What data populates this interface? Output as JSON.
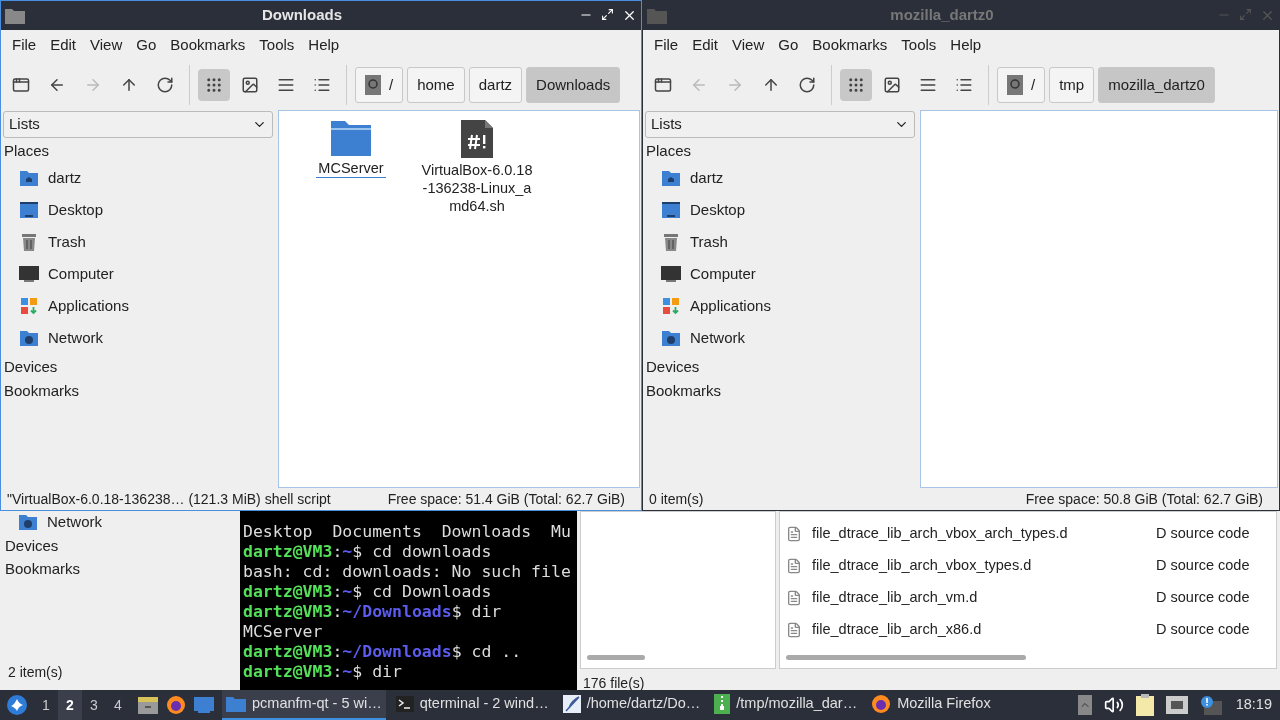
{
  "windows": [
    {
      "title": "Downloads",
      "active": true,
      "menu": [
        "File",
        "Edit",
        "View",
        "Go",
        "Bookmarks",
        "Tools",
        "Help"
      ],
      "back_disabled": false,
      "forward_disabled": true,
      "view_modes": [
        {
          "kind": "icons",
          "selected": true
        },
        {
          "kind": "thumbnails",
          "selected": false
        },
        {
          "kind": "compact",
          "selected": false
        },
        {
          "kind": "details",
          "selected": false
        }
      ],
      "path": [
        {
          "kind": "root",
          "label": "/",
          "selected": false
        },
        {
          "kind": "dir",
          "label": "home",
          "selected": false
        },
        {
          "kind": "dir",
          "label": "dartz",
          "selected": false
        },
        {
          "kind": "dir",
          "label": "Downloads",
          "selected": true
        }
      ],
      "panel_mode": "Lists",
      "sidebar": [
        {
          "label": "Places",
          "items": [
            {
              "kind": "home",
              "label": "dartz"
            },
            {
              "kind": "desktop",
              "label": "Desktop"
            },
            {
              "kind": "trash",
              "label": "Trash"
            },
            {
              "kind": "computer",
              "label": "Computer"
            },
            {
              "kind": "apps",
              "label": "Applications"
            },
            {
              "kind": "network",
              "label": "Network"
            }
          ]
        },
        {
          "label": "Devices"
        },
        {
          "label": "Bookmarks"
        }
      ],
      "files": [
        {
          "kind": "folder",
          "name": "MCServer",
          "focused": true
        },
        {
          "kind": "script",
          "name": "VirtualBox-6.0.18-136238-Linux_amd64.sh",
          "focused": false
        }
      ],
      "status_left": "\"VirtualBox-6.0.18-136238… (121.3 MiB) shell script",
      "status_right": "Free space: 51.4 GiB (Total: 62.7 GiB)"
    },
    {
      "title": "mozilla_dartz0",
      "active": false,
      "menu": [
        "File",
        "Edit",
        "View",
        "Go",
        "Bookmarks",
        "Tools",
        "Help"
      ],
      "back_disabled": true,
      "forward_disabled": true,
      "view_modes": [
        {
          "kind": "icons",
          "selected": true
        },
        {
          "kind": "thumbnails",
          "selected": false
        },
        {
          "kind": "compact",
          "selected": false
        },
        {
          "kind": "details",
          "selected": false
        }
      ],
      "path": [
        {
          "kind": "root",
          "label": "/",
          "selected": false
        },
        {
          "kind": "dir",
          "label": "tmp",
          "selected": false
        },
        {
          "kind": "dir",
          "label": "mozilla_dartz0",
          "selected": true
        }
      ],
      "panel_mode": "Lists",
      "sidebar": [
        {
          "label": "Places",
          "items": [
            {
              "kind": "home",
              "label": "dartz"
            },
            {
              "kind": "desktop",
              "label": "Desktop"
            },
            {
              "kind": "trash",
              "label": "Trash"
            },
            {
              "kind": "computer",
              "label": "Computer"
            },
            {
              "kind": "apps",
              "label": "Applications"
            },
            {
              "kind": "network",
              "label": "Network"
            }
          ]
        },
        {
          "label": "Devices"
        },
        {
          "label": "Bookmarks"
        }
      ],
      "status_left": "0 item(s)",
      "status_right": "Free space: 50.8 GiB (Total: 62.7 GiB)"
    }
  ],
  "back_file_manager": {
    "items": [
      {
        "kind": "network",
        "label": "Network"
      }
    ],
    "sections": [
      "Devices",
      "Bookmarks"
    ],
    "status": "2 item(s)"
  },
  "terminal": {
    "lines": [
      {
        "kind": "output",
        "text": "Desktop  Documents  Downloads  Mu"
      },
      {
        "kind": "prompt",
        "user": "dartz@VM3",
        "sep": ":",
        "path": "~",
        "command": "$ cd downloads"
      },
      {
        "kind": "output",
        "text": "bash: cd: downloads: No such file"
      },
      {
        "kind": "prompt",
        "user": "dartz@VM3",
        "sep": ":",
        "path": "~",
        "command": "$ cd Downloads"
      },
      {
        "kind": "prompt",
        "user": "dartz@VM3",
        "sep": ":",
        "path": "~/Downloads",
        "command": "$ dir"
      },
      {
        "kind": "output",
        "text": "MCServer"
      },
      {
        "kind": "prompt",
        "user": "dartz@VM3",
        "sep": ":",
        "path": "~/Downloads",
        "command": "$ cd .."
      },
      {
        "kind": "prompt",
        "user": "dartz@VM3",
        "sep": ":",
        "path": "~",
        "command": "$ dir"
      }
    ]
  },
  "source_file_manager": {
    "rows": [
      {
        "name": "file_dtrace_lib_arch_vbox_arch_types.d",
        "type": "D source code"
      },
      {
        "name": "file_dtrace_lib_arch_vbox_types.d",
        "type": "D source code"
      },
      {
        "name": "file_dtrace_lib_arch_vm.d",
        "type": "D source code"
      },
      {
        "name": "file_dtrace_lib_arch_x86.d",
        "type": "D source code"
      }
    ],
    "status": "176 file(s)"
  },
  "taskbar": {
    "workspaces": [
      {
        "label": "1",
        "selected": false
      },
      {
        "label": "2",
        "selected": true
      },
      {
        "label": "3",
        "selected": false
      },
      {
        "label": "4",
        "selected": false
      }
    ],
    "launchers": [
      {
        "kind": "files"
      },
      {
        "kind": "firefox"
      },
      {
        "kind": "desktop"
      }
    ],
    "tasks": [
      {
        "kind": "folder",
        "label": "pcmanfm-qt - 5 wi…",
        "selected": true
      },
      {
        "kind": "terminal",
        "label": "qterminal - 2 wind…",
        "selected": false
      },
      {
        "kind": "editor",
        "label": "/home/dartz/Do…",
        "selected": false
      },
      {
        "kind": "archive",
        "label": "/tmp/mozilla_dar…",
        "selected": false
      },
      {
        "kind": "firefox",
        "label": "Mozilla Firefox",
        "selected": false
      }
    ],
    "tray": [
      {
        "kind": "up"
      },
      {
        "kind": "volume"
      },
      {
        "kind": "clipboard"
      },
      {
        "kind": "network"
      },
      {
        "kind": "update"
      }
    ],
    "clock": "18:19"
  }
}
